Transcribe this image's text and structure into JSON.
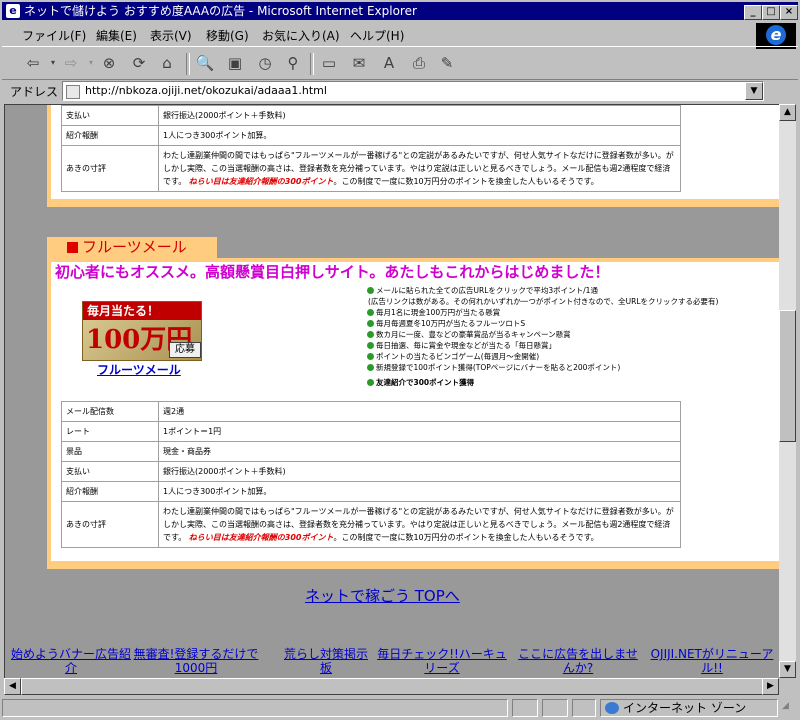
{
  "window": {
    "title": "ネットで儲けよう おすすめ度AAAの広告 - Microsoft Internet Explorer",
    "buttons": {
      "minimize": "_",
      "maximize": "□",
      "close": "×"
    }
  },
  "menu": [
    "ファイル(F)",
    "編集(E)",
    "表示(V)",
    "移動(G)",
    "お気に入り(A)",
    "ヘルプ(H)"
  ],
  "toolbar": {
    "icons": [
      "back-icon",
      "forward-icon",
      "stop-icon",
      "refresh-icon",
      "home-icon",
      "search-icon",
      "favorites-icon",
      "history-icon",
      "channels-icon",
      "fullscreen-icon",
      "mail-icon",
      "font-icon",
      "print-icon",
      "edit-icon"
    ]
  },
  "address": {
    "label": "アドレス",
    "url": "http://nbkoza.ojiji.net/okozukai/adaaa1.html"
  },
  "section1": {
    "rows": [
      {
        "key": "支払い",
        "value": "銀行振込(2000ポイント＋手数料)"
      },
      {
        "key": "紹介報酬",
        "value": "1人につき300ポイント加算。"
      }
    ],
    "comment_key": "あきの寸評",
    "comment_text": "わたし達副業仲間の間ではもっぱら\"フルーツメールが一番稼げる\"との定説があるみたいですが、何せ人気サイトなだけに登録者数が多い。がしかし実際、この当選報酬の高さは、登録者数を充分補っています。やはり定説は正しいと見るべきでしょう。メール配信も週2通程度で経済です。",
    "comment_red": "ねらい目は友達紹介報酬の300ポイント",
    "comment_tail": "。この制度で一度に数10万円分のポイントを換金した人もいるそうです。"
  },
  "section2": {
    "tab": "フルーツメール",
    "headline": "初心者にもオススメ。高額懸賞目白押しサイト。あたしもこれからはじめました！",
    "banner": {
      "line1": "毎月当たる！",
      "amount": "100万円",
      "badge": "応募"
    },
    "link": "フルーツメール",
    "bullets": [
      "メールに貼られた全ての広告URLをクリックで平均3ポイント/1通",
      "(広告リンクは数がある。その何れかいずれか一つがポイント付きなので、全URLをクリックする必要有)",
      "毎月1名に現金100万円が当たる懸賞",
      "毎月毎週夏冬10万円が当たるフルーツロトS",
      "数カ月に一度、豊などの豪華賞品が当るキャンペーン懸賞",
      "毎日抽選、毎に賞金や現金などが当たる「毎日懸賞」",
      "ポイントの当たるビンゴゲーム(毎週月〜金開催)",
      "新規登録で100ポイント獲得(TOPページにバナーを貼ると200ポイント)",
      "友達紹介で300ポイント獲得"
    ],
    "rows": [
      {
        "key": "メール配信数",
        "value": "週2通"
      },
      {
        "key": "レート",
        "value": "1ポイント＝1円"
      },
      {
        "key": "景品",
        "value": "現金・商品券"
      },
      {
        "key": "支払い",
        "value": "銀行振込(2000ポイント＋手数料)"
      },
      {
        "key": "紹介報酬",
        "value": "1人につき300ポイント加算。"
      }
    ],
    "comment_key": "あきの寸評",
    "comment_text": "わたし達副業仲間の間ではもっぱら\"フルーツメールが一番稼げる\"との定説があるみたいですが、何せ人気サイトなだけに登録者数が多い。がしかし実際、この当選報酬の高さは、登録者数を充分補っています。やはり定説は正しいと見るべきでしょう。メール配信も週2通程度で経済です。",
    "comment_red": "ねらい目は友達紹介報酬の300ポイント",
    "comment_tail": "。この制度で一度に数10万円分のポイントを換金した人もいるそうです。"
  },
  "top_link": "ネットで稼ごう TOPへ",
  "footer_links": [
    "始めようバナー広告紹介",
    "無審査!登録するだけで1000円",
    "荒らし対策掲示板",
    "毎日チェック!!ハーキュリーズ",
    "ここに広告を出しませんか?",
    "OJIJI.NETがリニューアル!!"
  ],
  "status": {
    "zone": "インターネット ゾーン"
  },
  "colors": {
    "titlebar": "#000080",
    "page_bg": "#999999",
    "box": "#ffcc80",
    "headline": "#d000d0",
    "red": "#e00000",
    "link": "#0000cc"
  }
}
